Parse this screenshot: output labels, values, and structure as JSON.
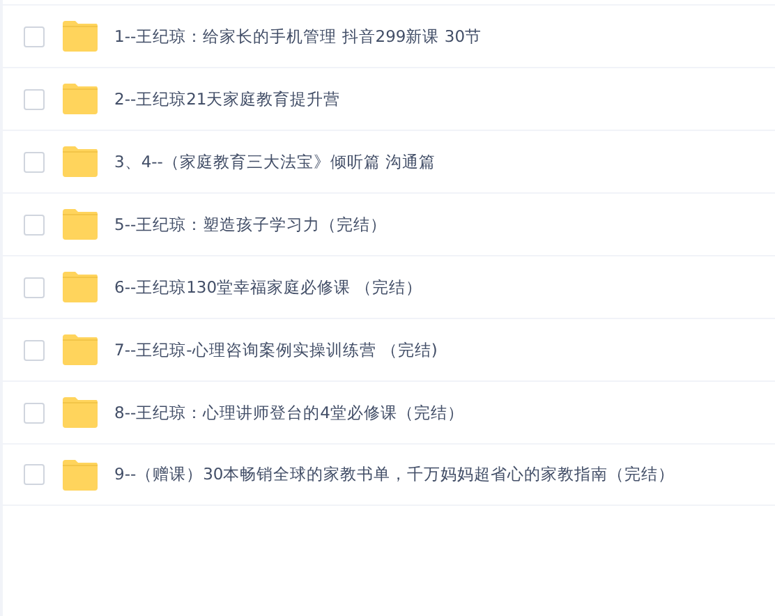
{
  "files": [
    {
      "name": "1--王纪琼：给家长的手机管理 抖音299新课 30节",
      "checked": false
    },
    {
      "name": "2--王纪琼21天家庭教育提升营",
      "checked": false
    },
    {
      "name": "3、4--（家庭教育三大法宝》倾听篇 沟通篇",
      "checked": false
    },
    {
      "name": "5--王纪琼：塑造孩子学习力（完结）",
      "checked": false
    },
    {
      "name": "6--王纪琼130堂幸福家庭必修课 （完结）",
      "checked": false
    },
    {
      "name": "7--王纪琼-心理咨询案例实操训练营 （完结)",
      "checked": false
    },
    {
      "name": "8--王纪琼：心理讲师登台的4堂必修课（完结）",
      "checked": false
    },
    {
      "name": "9--（赠课）30本畅销全球的家教书单，千万妈妈超省心的家教指南（完结）",
      "checked": false
    }
  ]
}
